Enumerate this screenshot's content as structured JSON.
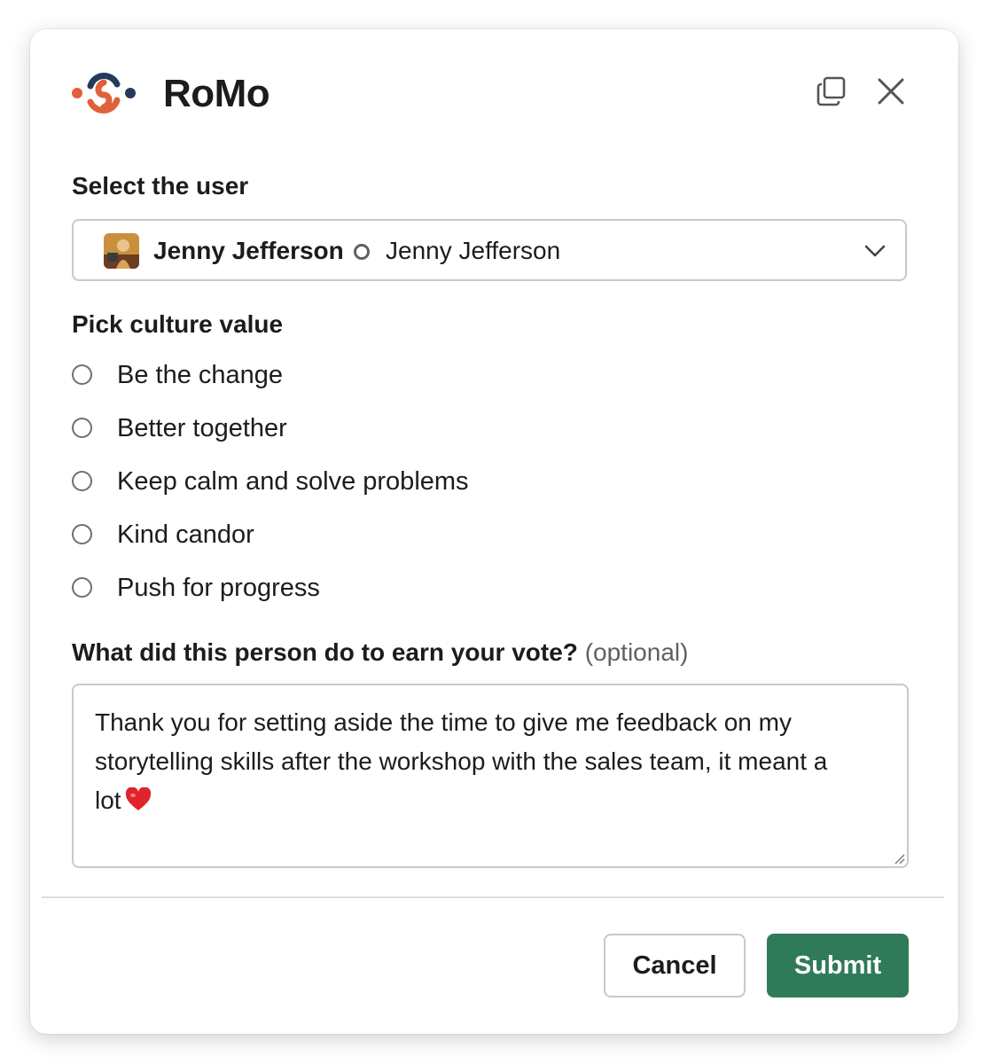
{
  "app": {
    "title": "RoMo",
    "logo_icon": "romo-logo-icon",
    "brand_colors": {
      "orange": "#E0603A",
      "navy": "#243B5C"
    }
  },
  "header": {
    "copy_icon": "copy-icon",
    "close_icon": "close-icon"
  },
  "user_select": {
    "label": "Select the user",
    "selected_name": "Jenny Jefferson",
    "display_name": "Jenny Jefferson",
    "presence": "away",
    "chevron_icon": "chevron-down-icon"
  },
  "culture": {
    "label": "Pick culture value",
    "options": [
      {
        "label": "Be the change",
        "selected": false
      },
      {
        "label": "Better together",
        "selected": false
      },
      {
        "label": "Keep calm and solve problems",
        "selected": false
      },
      {
        "label": "Kind candor",
        "selected": false
      },
      {
        "label": "Push for progress",
        "selected": false
      }
    ]
  },
  "vote_reason": {
    "label": "What did this person do to earn your vote?",
    "optional": "(optional)",
    "value": "Thank you for setting aside the time to give me feedback on my storytelling skills after the workshop with the sales team, it meant a lot",
    "emoji": "heart-icon"
  },
  "footer": {
    "cancel_label": "Cancel",
    "submit_label": "Submit",
    "submit_color": "#2F7A59"
  }
}
